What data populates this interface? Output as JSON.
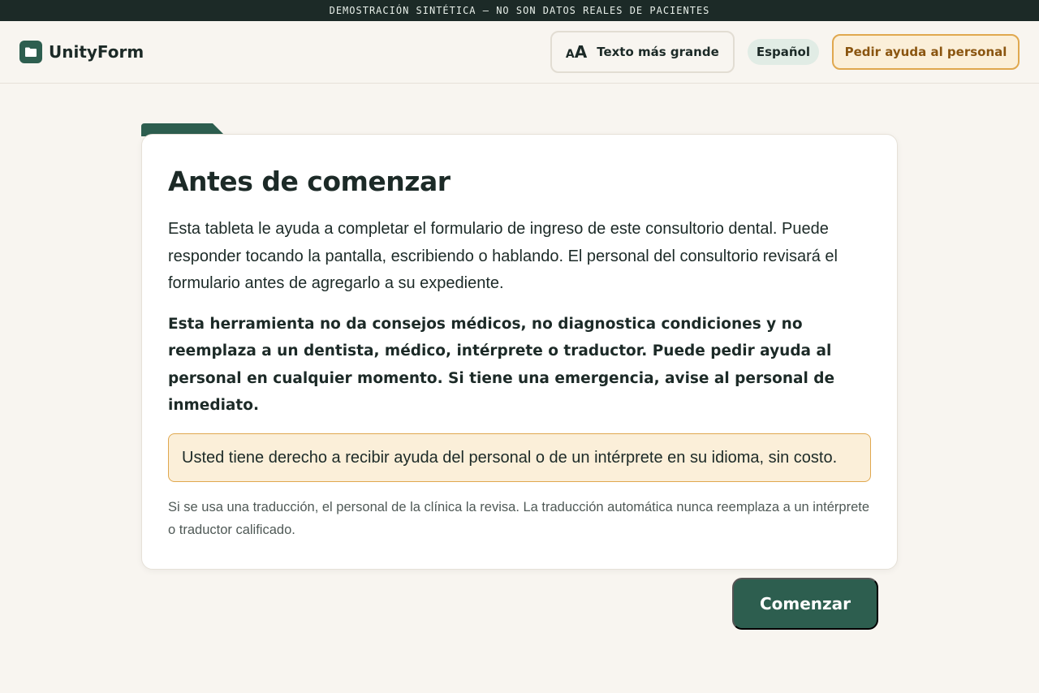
{
  "banner": {
    "text": "DEMOSTRACIÓN SINTÉTICA — NO SON DATOS REALES DE PACIENTES"
  },
  "header": {
    "brand_name": "UnityForm",
    "logo_icon": "folder-icon",
    "text_size": {
      "icon_small": "A",
      "icon_big": "A",
      "label": "Texto más grande"
    },
    "language": "Español",
    "help_label": "Pedir ayuda al personal"
  },
  "card": {
    "title": "Antes de comenzar",
    "intro": "Esta tableta le ayuda a completar el formulario de ingreso de este consultorio dental. Puede responder tocando la pantalla, escribiendo o hablando. El personal del consultorio revisará el formulario antes de agregarlo a su expediente.",
    "disclaimer": "Esta herramienta no da consejos médicos, no diagnostica condiciones y no reemplaza a un dentista, médico, intérprete o traductor. Puede pedir ayuda al personal en cualquier momento. Si tiene una emergencia, avise al personal de inmediato.",
    "rights": "Usted tiene derecho a recibir ayuda del personal o de un intérprete en su idioma, sin costo.",
    "note": "Si se usa una traducción, el personal de la clínica la revisa. La traducción automática nunca reemplaza a un intérprete o traductor calificado."
  },
  "start_label": "Comenzar",
  "colors": {
    "primary": "#2d5e4f",
    "accent": "#e0a84f",
    "accent_bg": "#fbefd9",
    "background": "#f8f5f0",
    "banner_bg": "#1c2a27"
  }
}
